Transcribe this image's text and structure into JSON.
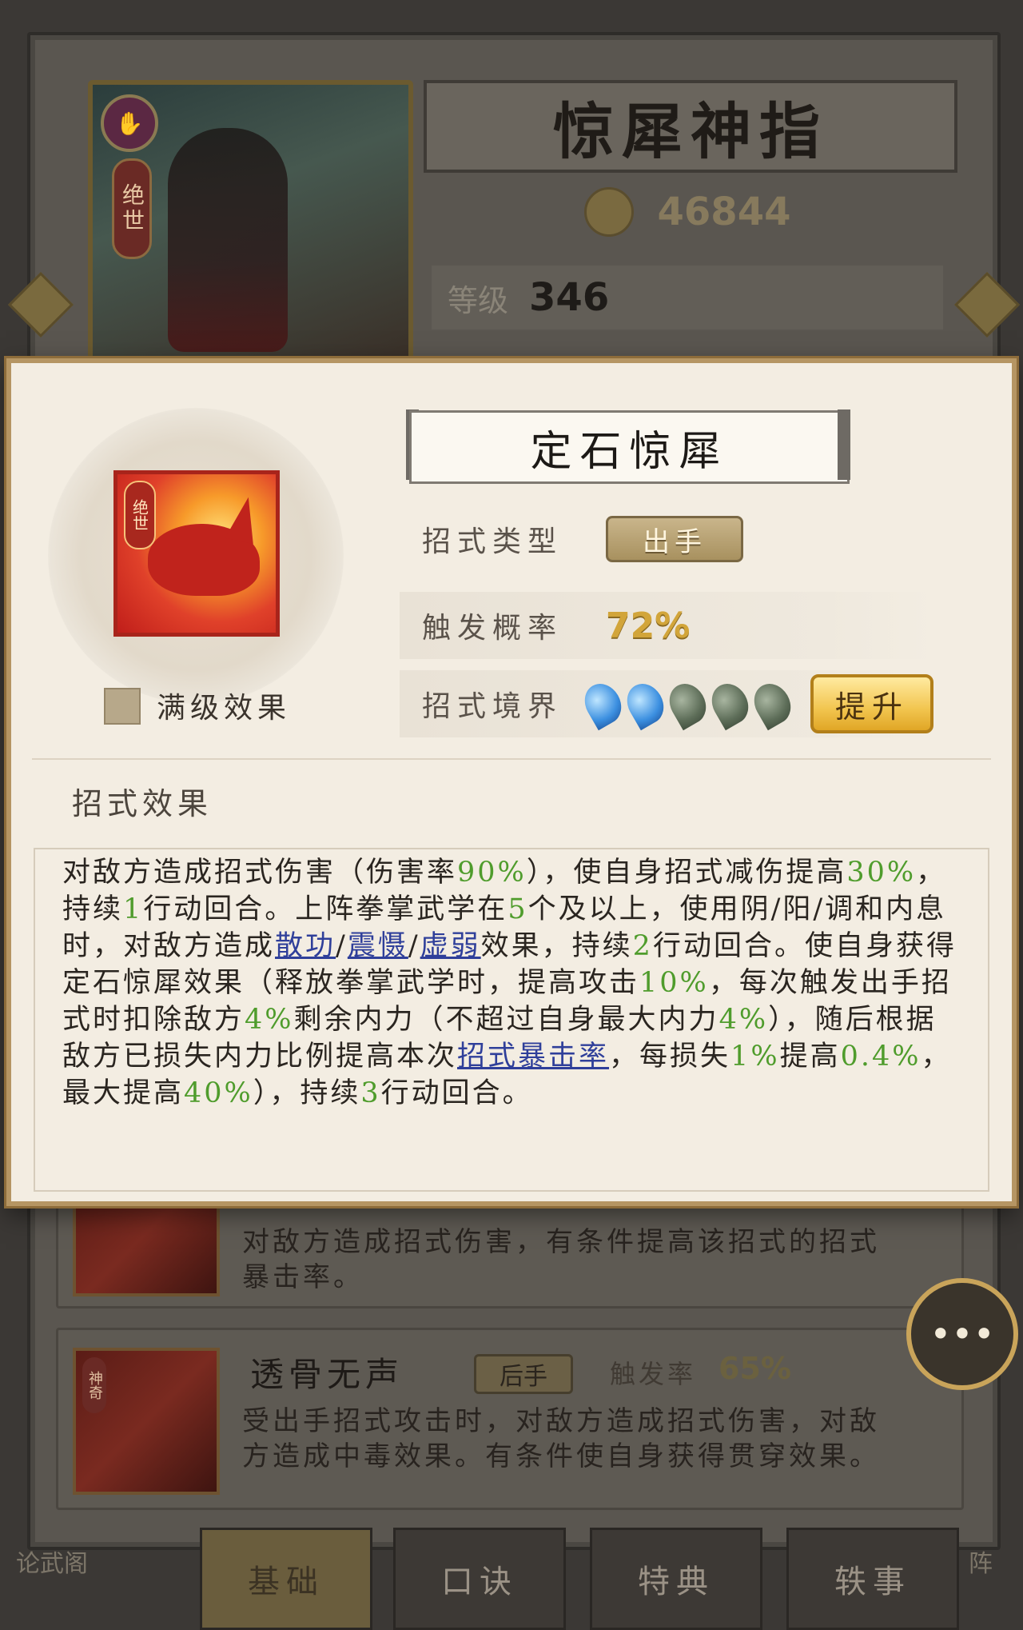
{
  "background": {
    "martial_art_title": "惊犀神指",
    "power_value": "46844",
    "level_label": "等级",
    "level_value": "346",
    "portrait_tag": "绝世",
    "skill_list": [
      {
        "description": "对敌方造成招式伤害，有条件提高该招式的招式暴击率。"
      },
      {
        "name": "透骨无声",
        "type_tag": "后手",
        "rate_label": "触发率",
        "rate_value": "65%",
        "thumb_tag": "神奇",
        "description": "受出手招式攻击时，对敌方造成招式伤害，对敌方造成中毒效果。有条件使自身获得贯穿效果。"
      }
    ],
    "bottom_tabs": [
      "基础",
      "口诀",
      "特典",
      "轶事"
    ],
    "left_corner_label": "论武阁",
    "right_corner_label": "阵"
  },
  "modal": {
    "skill_name": "定石惊犀",
    "icon_tag": "绝世",
    "max_level_label": "满级效果",
    "type_label": "招式类型",
    "type_value": "出手",
    "trigger_label": "触发概率",
    "trigger_value": "72%",
    "realm_label": "招式境界",
    "realm_level": 2,
    "realm_max": 5,
    "upgrade_label": "提升",
    "effect_title": "招式效果",
    "effect_segments": [
      {
        "t": "对敌方造成招式伤害（伤害率"
      },
      {
        "t": "90%",
        "s": "g"
      },
      {
        "t": "），使自身招式减伤提高"
      },
      {
        "t": "30%",
        "s": "g"
      },
      {
        "t": "，持续"
      },
      {
        "t": "1",
        "s": "g"
      },
      {
        "t": "行动回合。上阵拳掌武学在"
      },
      {
        "t": "5",
        "s": "g"
      },
      {
        "t": "个及以上，使用阴/阳/调和内息时，对敌方造成"
      },
      {
        "t": "散功",
        "s": "lk"
      },
      {
        "t": "/"
      },
      {
        "t": "震慑",
        "s": "lk"
      },
      {
        "t": "/"
      },
      {
        "t": "虚弱",
        "s": "lk"
      },
      {
        "t": "效果，持续"
      },
      {
        "t": "2",
        "s": "g"
      },
      {
        "t": "行动回合。使自身获得定石惊犀效果（释放拳掌武学时，提高攻击"
      },
      {
        "t": "10%",
        "s": "g"
      },
      {
        "t": "，每次触发出手招式时扣除敌方"
      },
      {
        "t": "4%",
        "s": "g"
      },
      {
        "t": "剩余内力（不超过自身最大内力"
      },
      {
        "t": "4%",
        "s": "g"
      },
      {
        "t": "），随后根据敌方已损失内力比例提高本次"
      },
      {
        "t": "招式暴击率",
        "s": "lk"
      },
      {
        "t": "，每损失"
      },
      {
        "t": "1%",
        "s": "g"
      },
      {
        "t": "提高"
      },
      {
        "t": "0.4%",
        "s": "g"
      },
      {
        "t": "，最大提高"
      },
      {
        "t": "40%",
        "s": "g"
      },
      {
        "t": "），持续"
      },
      {
        "t": "3",
        "s": "g"
      },
      {
        "t": "行动回合。"
      }
    ]
  },
  "chat_button_label": "•••",
  "colors": {
    "highlight_green": "#4f9c2c",
    "link_blue": "#2f3f9a",
    "gold": "#d2a53a",
    "modal_bg": "#f3ede2"
  }
}
